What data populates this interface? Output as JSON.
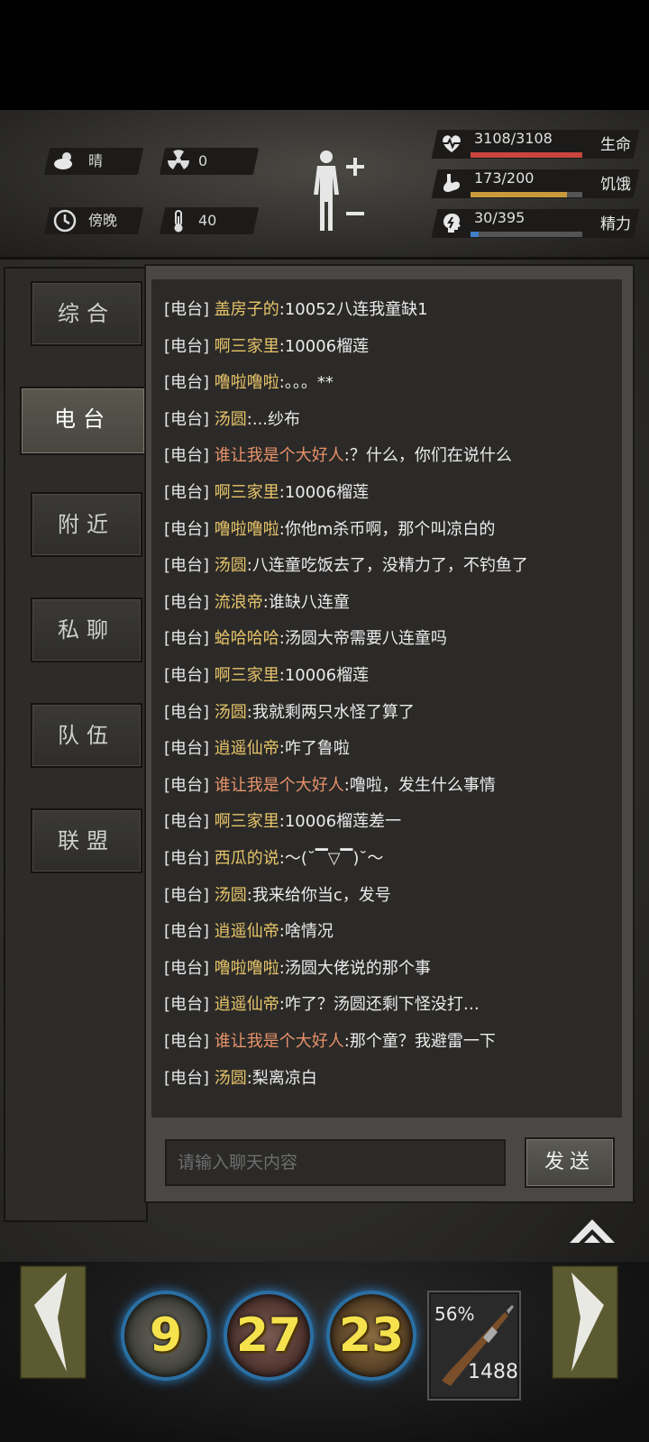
{
  "status": {
    "weather": {
      "icon": "cloud-sun-icon",
      "label": "晴"
    },
    "radiation": {
      "icon": "radiation-icon",
      "value": "0"
    },
    "time": {
      "icon": "clock-icon",
      "label": "傍晚"
    },
    "temperature": {
      "icon": "thermometer-icon",
      "value": "40"
    }
  },
  "stats": [
    {
      "name": "health",
      "icon": "heart-pulse-icon",
      "value": "3108/3108",
      "label": "生命",
      "fraction": 1.0,
      "color": "#c9453f"
    },
    {
      "name": "hunger",
      "icon": "stomach-icon",
      "value": "173/200",
      "label": "饥饿",
      "fraction": 0.865,
      "color": "#c99a3c"
    },
    {
      "name": "energy",
      "icon": "brain-icon",
      "value": "30/395",
      "label": "精力",
      "fraction": 0.076,
      "color": "#3f7fc9"
    }
  ],
  "tabs": [
    {
      "label": "综合",
      "active": false
    },
    {
      "label": "电台",
      "active": true
    },
    {
      "label": "附近",
      "active": false
    },
    {
      "label": "私聊",
      "active": false
    },
    {
      "label": "队伍",
      "active": false
    },
    {
      "label": "联盟",
      "active": false
    }
  ],
  "chat": {
    "messages": [
      {
        "channel": "[电台]",
        "name": "盖房子的",
        "special": false,
        "text": ":10052八连我童缺1"
      },
      {
        "channel": "[电台]",
        "name": "啊三家里",
        "special": false,
        "text": ":10006榴莲"
      },
      {
        "channel": "[电台]",
        "name": "噜啦噜啦",
        "special": false,
        "text": ":。。。**"
      },
      {
        "channel": "[电台]",
        "name": "汤圆",
        "special": false,
        "text": ":...纱布"
      },
      {
        "channel": "[电台]",
        "name": "谁让我是个大好人",
        "special": true,
        "text": ":？什么，你们在说什么"
      },
      {
        "channel": "[电台]",
        "name": "啊三家里",
        "special": false,
        "text": ":10006榴莲"
      },
      {
        "channel": "[电台]",
        "name": "噜啦噜啦",
        "special": false,
        "text": ":你他m杀币啊，那个叫凉白的"
      },
      {
        "channel": "[电台]",
        "name": "汤圆",
        "special": false,
        "text": ":八连童吃饭去了，没精力了，不钓鱼了"
      },
      {
        "channel": "[电台]",
        "name": "流浪帝",
        "special": false,
        "text": ":谁缺八连童"
      },
      {
        "channel": "[电台]",
        "name": "蛤哈哈哈",
        "special": false,
        "text": ":汤圆大帝需要八连童吗"
      },
      {
        "channel": "[电台]",
        "name": "啊三家里",
        "special": false,
        "text": ":10006榴莲"
      },
      {
        "channel": "[电台]",
        "name": "汤圆",
        "special": false,
        "text": ":我就剩两只水怪了算了"
      },
      {
        "channel": "[电台]",
        "name": "逍遥仙帝",
        "special": false,
        "text": ":咋了鲁啦"
      },
      {
        "channel": "[电台]",
        "name": "谁让我是个大好人",
        "special": true,
        "text": ":噜啦，发生什么事情"
      },
      {
        "channel": "[电台]",
        "name": "啊三家里",
        "special": false,
        "text": ":10006榴莲差一"
      },
      {
        "channel": "[电台]",
        "name": "西瓜的说",
        "special": false,
        "text": ":～(˘▔▽▔)˘～"
      },
      {
        "channel": "[电台]",
        "name": "汤圆",
        "special": false,
        "text": ":我来给你当c，发号"
      },
      {
        "channel": "[电台]",
        "name": "逍遥仙帝",
        "special": false,
        "text": ":啥情况"
      },
      {
        "channel": "[电台]",
        "name": "噜啦噜啦",
        "special": false,
        "text": ":汤圆大佬说的那个事"
      },
      {
        "channel": "[电台]",
        "name": "逍遥仙帝",
        "special": false,
        "text": ":咋了？汤圆还剩下怪没打…"
      },
      {
        "channel": "[电台]",
        "name": "谁让我是个大好人",
        "special": true,
        "text": ":那个童？我避雷一下"
      },
      {
        "channel": "[电台]",
        "name": "汤圆",
        "special": false,
        "text": ":梨离凉白"
      }
    ],
    "input_placeholder": "请输入聊天内容",
    "send_label": "发送"
  },
  "hotbar": {
    "skills": [
      {
        "icon": "eagle-icon",
        "count": "9"
      },
      {
        "icon": "crosshair-icon",
        "count": "27"
      },
      {
        "icon": "fish-icon",
        "count": "23"
      }
    ],
    "weapon": {
      "icon": "rifle-icon",
      "durability": "56%",
      "ammo": "1488"
    }
  }
}
